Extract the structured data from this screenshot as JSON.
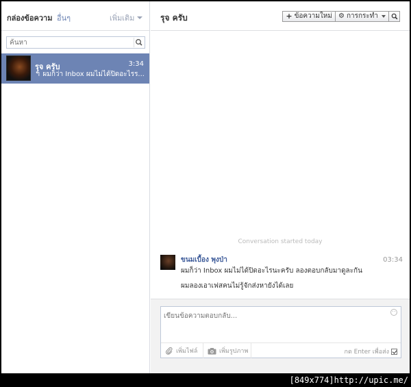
{
  "left_header": {
    "title": "กล่องข้อความ",
    "other": "อื่นๆ",
    "more": "เพิ่มเติม"
  },
  "search": {
    "placeholder": "ค้นหา"
  },
  "threads": [
    {
      "name": "รุจ ครับ",
      "time": "3:34",
      "snippet_icon": "reply-arrow-icon",
      "snippet": "ผมก็ว่า Inbox ผมไม่ได้ปิดอะไรร..."
    }
  ],
  "conversation": {
    "title": "รุจ ครับ",
    "new_message_label": "ข้อความใหม่",
    "actions_label": "การกระทำ",
    "started_text": "Conversation started today",
    "message": {
      "sender": "ขนมเบื้อง พุงป่า",
      "time": "03:34",
      "lines": [
        "ผมก็ว่า Inbox ผมไม่ได้ปิดอะไรนะครับ ลองตอบกลับมาดูละกัน",
        "ผมลองเอาเฟสคนไม่รู้จักส่งหายังได้เลย"
      ]
    }
  },
  "composer": {
    "placeholder": "เขียนข้อความตอบกลับ...",
    "add_file": "เพิ่มไฟล์",
    "add_photo": "เพิ่มรูปภาพ",
    "enter_to_send": "กด Enter เพื่อส่ง",
    "enter_to_send_checked": true
  },
  "watermark": "[849x774]http://upic.me/",
  "colors": {
    "selected_thread_bg": "#6d84b4",
    "link_blue": "#3b5998",
    "border": "#dddfe2"
  }
}
